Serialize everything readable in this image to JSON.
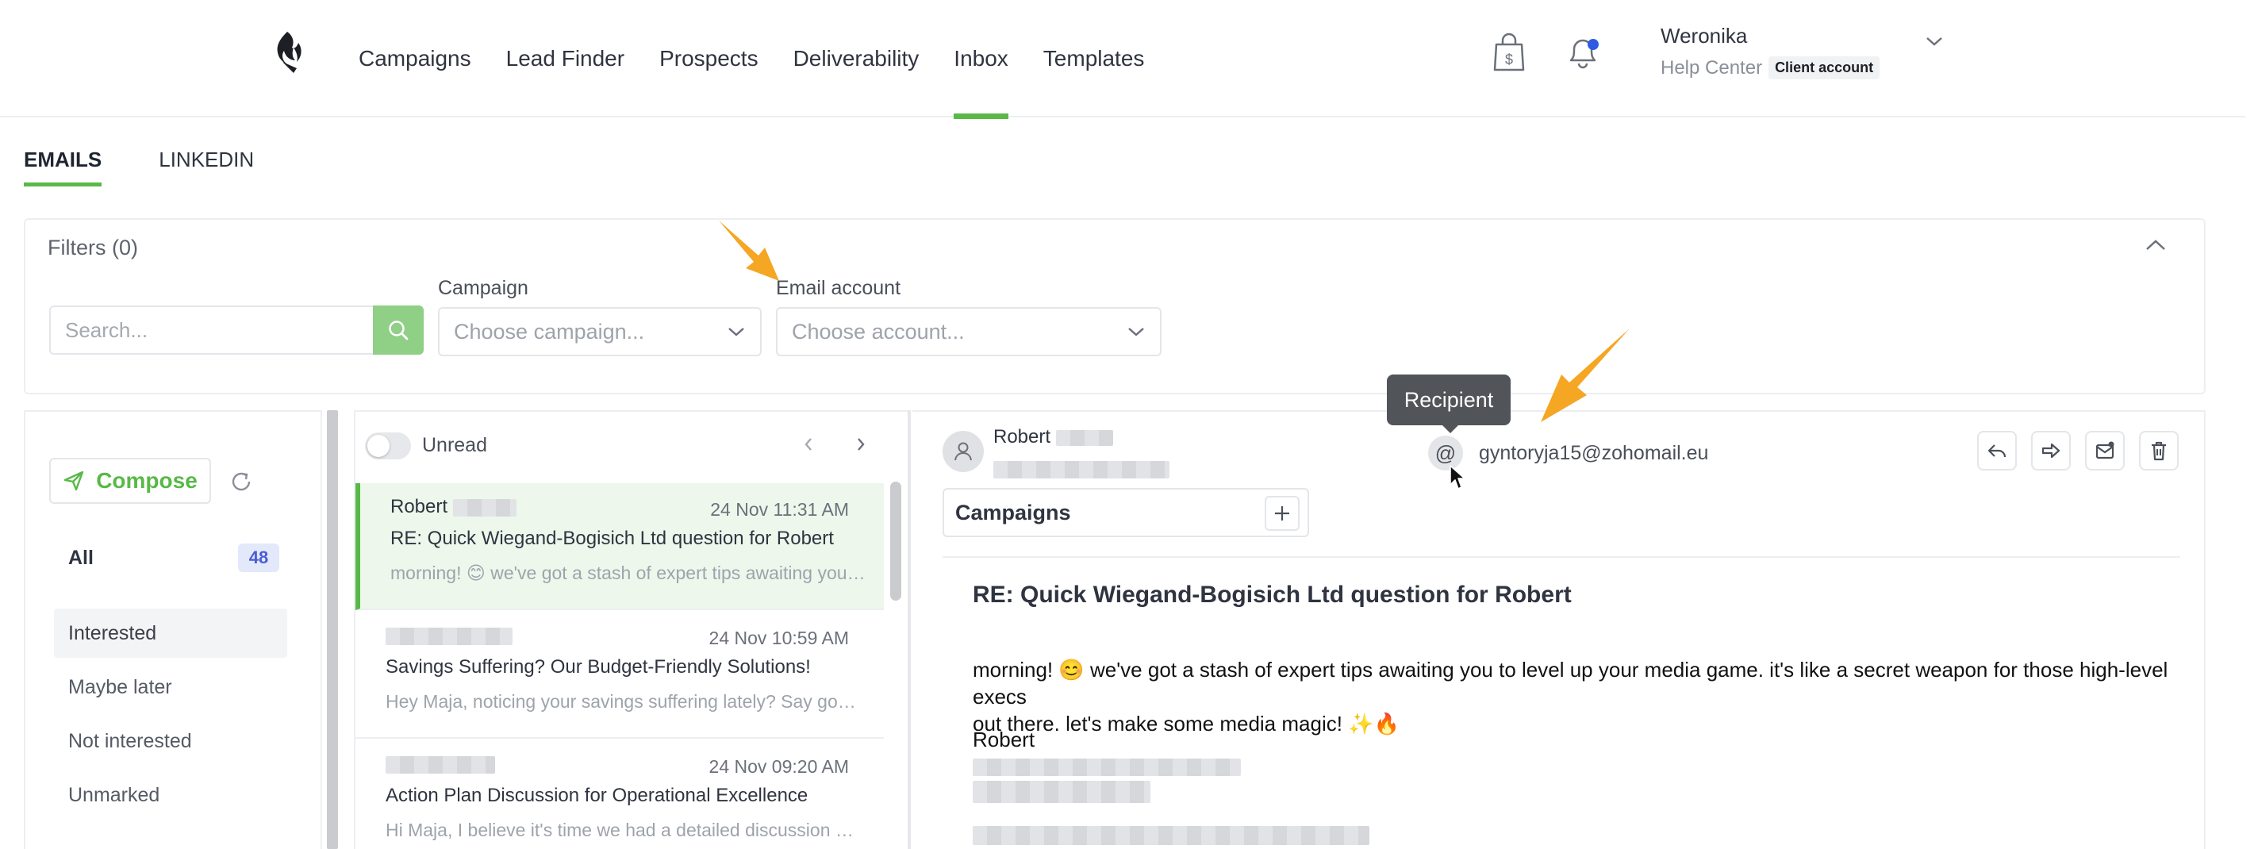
{
  "nav": {
    "items": [
      {
        "label": "Campaigns",
        "active": false
      },
      {
        "label": "Lead Finder",
        "active": false
      },
      {
        "label": "Prospects",
        "active": false
      },
      {
        "label": "Deliverability",
        "active": false
      },
      {
        "label": "Inbox",
        "active": true
      },
      {
        "label": "Templates",
        "active": false
      }
    ],
    "icons": [
      "logo-icon",
      "shopping-bag-dollar-icon",
      "bell-icon",
      "chevron-down-icon"
    ]
  },
  "user": {
    "name": "Weronika",
    "help_label": "Help Center",
    "account_badge": "Client account"
  },
  "tabs": [
    {
      "label": "EMAILS",
      "active": true
    },
    {
      "label": "LINKEDIN",
      "active": false
    }
  ],
  "filters": {
    "title": "Filters (0)",
    "search_placeholder": "Search...",
    "campaign_label": "Campaign",
    "campaign_placeholder": "Choose campaign...",
    "account_label": "Email account",
    "account_placeholder": "Choose account..."
  },
  "sidebar": {
    "compose_label": "Compose",
    "all_label": "All",
    "all_count": "48",
    "folders": [
      "Interested",
      "Maybe later",
      "Not interested",
      "Unmarked"
    ],
    "selected_folder": "Interested"
  },
  "list": {
    "unread_label": "Unread",
    "unread_toggle_on": false,
    "emails": [
      {
        "sender": "Robert",
        "date": "24 Nov 11:31 AM",
        "subject": "RE: Quick Wiegand-Bogisich Ltd question for Robert",
        "preview": "morning! 😊 we've got a stash of expert tips awaiting you to level up your media game.",
        "active": true
      },
      {
        "sender": "",
        "date": "24 Nov 10:59 AM",
        "subject": "Savings Suffering? Our Budget-Friendly Solutions!",
        "preview": "Hey Maja, noticing your savings suffering lately? Say goodbye to budget worries.",
        "active": false
      },
      {
        "sender": "",
        "date": "24 Nov 09:20 AM",
        "subject": "Action Plan Discussion for Operational Excellence",
        "preview": "Hi Maja, I believe it's time we had a detailed discussion about our action plan.",
        "active": false
      }
    ]
  },
  "reader": {
    "sender": "Robert",
    "recipient_tooltip": "Recipient",
    "recipient_email": "gyntoryja15@zohomail.eu",
    "campaigns_label": "Campaigns",
    "subject": "RE: Quick Wiegand-Bogisich Ltd question for Robert",
    "body_line1": "morning! 😊 we've got a stash of expert tips awaiting you to level up your media game. it's like a secret weapon for those high-level execs",
    "body_line2": "out there. let's make some media magic! ✨🔥",
    "signature": "Robert",
    "actions": [
      "reply-icon",
      "forward-icon",
      "mark-unread-icon",
      "trash-icon"
    ]
  },
  "colors": {
    "accent": "#58b947",
    "annotation_arrow": "#f5a623",
    "tooltip_bg": "#515459",
    "badge_bg": "#e4e8fb"
  }
}
